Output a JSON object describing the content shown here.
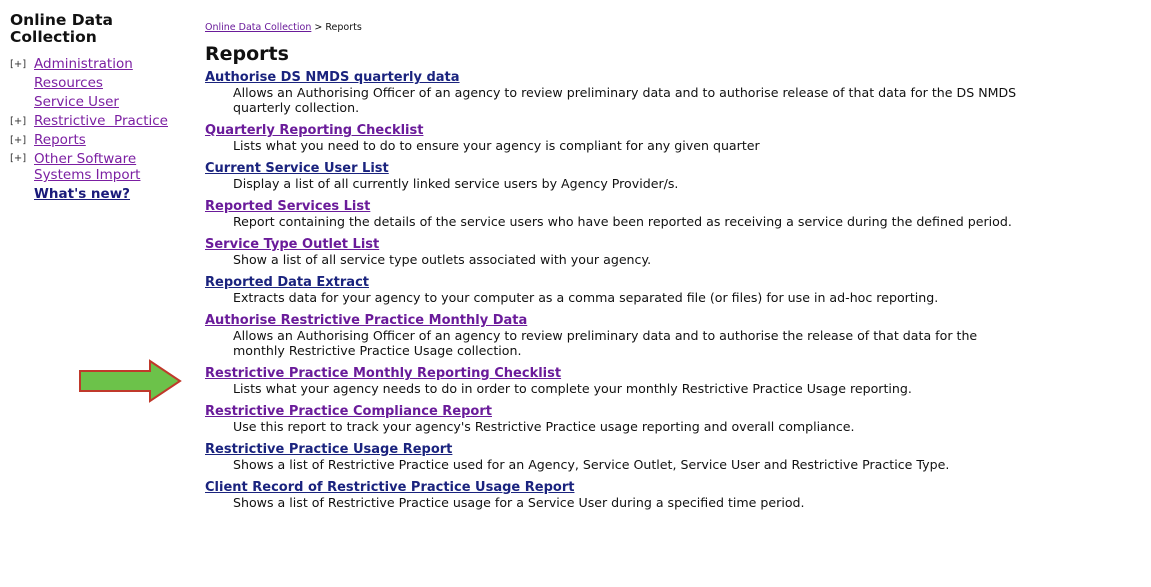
{
  "sidebar": {
    "title": "Online Data\nCollection",
    "items": [
      {
        "expander": "[+]",
        "label": "Administration"
      },
      {
        "expander": "",
        "label": "Resources"
      },
      {
        "expander": "",
        "label": "Service User"
      },
      {
        "expander": "[+]",
        "label": "Restrictive  Practice"
      },
      {
        "expander": "[+]",
        "label": "Reports"
      },
      {
        "expander": "[+]",
        "label": "Other Software Systems Import"
      },
      {
        "expander": "",
        "label": "What's new?"
      }
    ]
  },
  "breadcrumb": {
    "link": "Online Data Collection",
    "separator": " > ",
    "current": "Reports"
  },
  "page_title": "Reports",
  "reports": [
    {
      "title": "Authorise DS NMDS quarterly data",
      "desc": "Allows an Authorising Officer of an agency to review preliminary data and to authorise release of that data for the DS NMDS\nquarterly collection."
    },
    {
      "title": "Quarterly Reporting Checklist",
      "desc": "Lists what you need to do to ensure your agency is compliant for any given quarter"
    },
    {
      "title": "Current Service User List",
      "desc": "Display a list of all currently linked service users by Agency Provider/s."
    },
    {
      "title": "Reported Services List",
      "desc": "Report containing the details of the service users who have been reported as receiving a service during the defined period."
    },
    {
      "title": "Service Type Outlet List",
      "desc": "Show a list of all service type outlets associated with your agency."
    },
    {
      "title": "Reported Data Extract",
      "desc": "Extracts data for your agency to your computer as a comma separated file (or files) for use in ad-hoc reporting."
    },
    {
      "title": "Authorise Restrictive Practice Monthly Data",
      "desc": "Allows an Authorising Officer of an agency to review preliminary data and to authorise the release of that data for the\nmonthly Restrictive Practice Usage collection."
    },
    {
      "title": "Restrictive Practice Monthly Reporting Checklist",
      "desc": "Lists what your agency needs to do in order to complete your monthly Restrictive Practice Usage reporting."
    },
    {
      "title": "Restrictive Practice Compliance Report",
      "desc": "Use this report to track your agency's Restrictive Practice usage reporting and overall compliance."
    },
    {
      "title": "Restrictive Practice Usage Report",
      "desc": "Shows a list of Restrictive Practice used for an Agency, Service Outlet, Service User and Restrictive Practice Type."
    },
    {
      "title": "Client Record of Restrictive Practice Usage Report",
      "desc": "Shows a list of Restrictive Practice usage for a Service User during a specified time period."
    }
  ],
  "colors": {
    "link_purple": "#6a1b9a",
    "link_blue": "#1a237e",
    "arrow_green": "#6cc24a",
    "arrow_border": "#c0392b"
  },
  "icons": {
    "highlight_arrow": "right-arrow-icon"
  }
}
